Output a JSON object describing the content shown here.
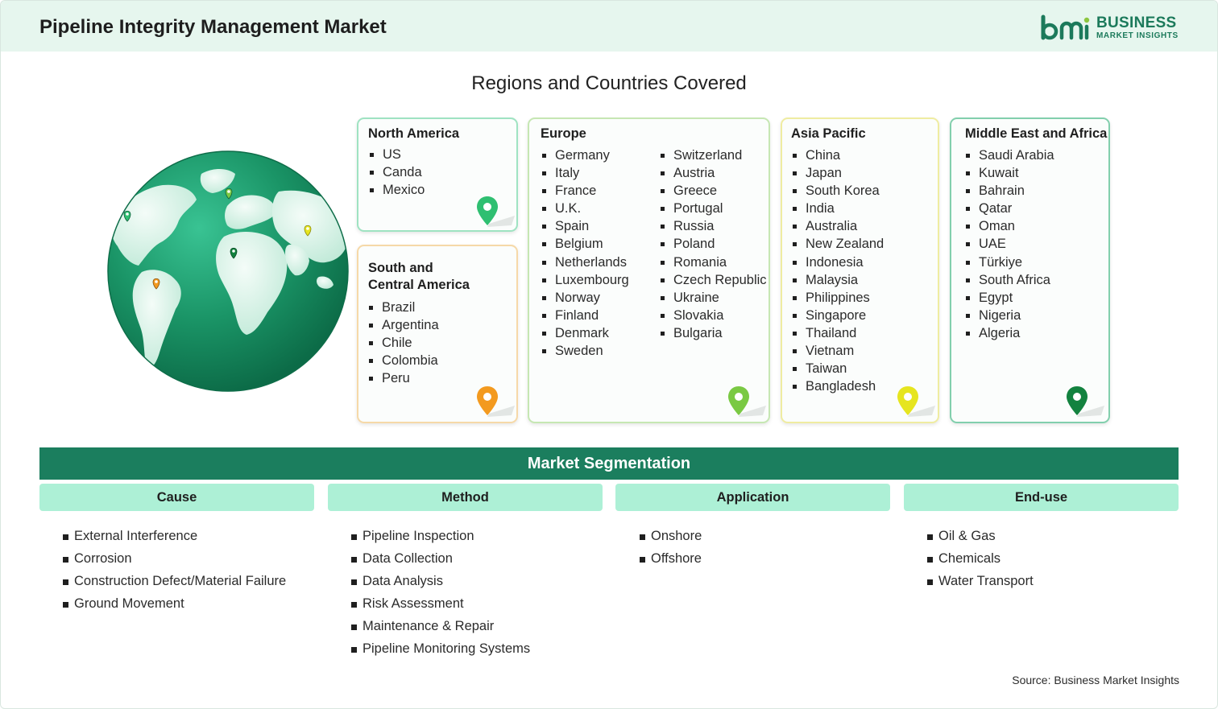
{
  "header": {
    "title": "Pipeline Integrity Management Market",
    "logo_top": "BUSINESS",
    "logo_bottom": "MARKET INSIGHTS"
  },
  "regions_title": "Regions and Countries Covered",
  "regions": {
    "north_america": {
      "title": "North America",
      "countries": [
        "US",
        "Canda",
        "Mexico"
      ],
      "pin_color": "#2fbf71"
    },
    "south_america": {
      "title_line1": "South and",
      "title_line2": "Central America",
      "countries": [
        "Brazil",
        "Argentina",
        "Chile",
        "Colombia",
        "Peru"
      ],
      "pin_color": "#f39a1f"
    },
    "europe": {
      "title": "Europe",
      "countries_col1": [
        "Germany",
        "Italy",
        "France",
        "U.K.",
        "Spain",
        "Belgium",
        "Netherlands",
        "Luxembourg",
        "Norway",
        "Finland",
        "Denmark",
        "Sweden"
      ],
      "countries_col2": [
        "Switzerland",
        "Austria",
        "Greece",
        "Portugal",
        "Russia",
        "Poland",
        "Romania",
        "Czech Republic",
        "Ukraine",
        "Slovakia",
        "Bulgaria"
      ],
      "pin_color": "#7ac943"
    },
    "asia_pacific": {
      "title": "Asia Pacific",
      "countries": [
        "China",
        "Japan",
        "South Korea",
        "India",
        "Australia",
        "New Zealand",
        "Indonesia",
        "Malaysia",
        "Philippines",
        "Singapore",
        "Thailand",
        "Vietnam",
        "Taiwan",
        "Bangladesh"
      ],
      "pin_color": "#e6e51f"
    },
    "middle_east_africa": {
      "title": "Middle East and Africa",
      "countries": [
        "Saudi Arabia",
        "Kuwait",
        "Bahrain",
        "Qatar",
        "Oman",
        "UAE",
        "Türkiye",
        "South Africa",
        "Egypt",
        "Nigeria",
        "Algeria"
      ],
      "pin_color": "#13823f"
    }
  },
  "segmentation": {
    "title": "Market Segmentation",
    "columns": [
      {
        "heading": "Cause",
        "items": [
          "External Interference",
          "Corrosion",
          "Construction Defect/Material Failure",
          "Ground Movement"
        ]
      },
      {
        "heading": "Method",
        "items": [
          "Pipeline Inspection",
          "Data Collection",
          "Data Analysis",
          "Risk Assessment",
          "Maintenance & Repair",
          "Pipeline Monitoring Systems"
        ]
      },
      {
        "heading": "Application",
        "items": [
          "Onshore",
          "Offshore"
        ]
      },
      {
        "heading": "End-use",
        "items": [
          "Oil & Gas",
          "Chemicals",
          "Water Transport"
        ]
      }
    ]
  },
  "source": "Source: Business Market Insights",
  "icons": {
    "globe": "globe-icon",
    "pin": "map-pin-icon",
    "logo": "bmi-logo-icon"
  },
  "colors": {
    "brand_green": "#1b7e5e",
    "header_bg": "#e6f6ee",
    "segment_head_bg": "#adf0d6"
  }
}
